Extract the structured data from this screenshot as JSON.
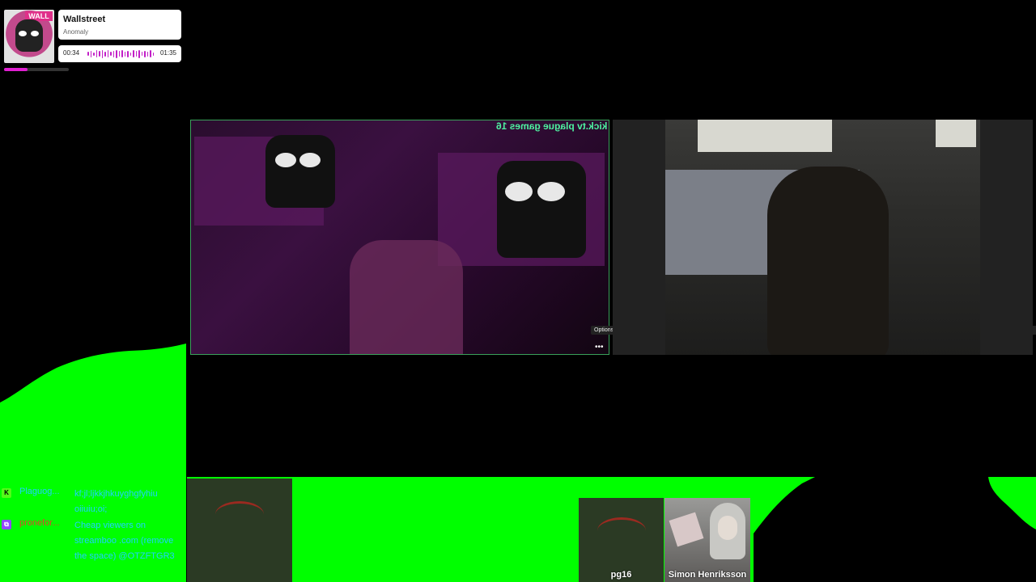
{
  "now_playing": {
    "album_art_text": "WALL",
    "title": "Wallstreet",
    "artist": "Anomaly",
    "elapsed": "00:34",
    "total": "01:35",
    "progress_fraction": 0.36,
    "accent_color": "#e11fd2"
  },
  "chat": {
    "messages": [
      {
        "platform": "kick",
        "platform_icon": "K",
        "username": "Plaguog...",
        "user_color": "#1fd0ff",
        "message": "kf;jl;ljkkjhkuyghgfyhiu oiiuiu;oi;"
      },
      {
        "platform": "twitch",
        "platform_icon": "⧉",
        "username": "pronefor...",
        "user_color": "#e0442c",
        "message": "Cheap viewers on streamboo .com (remove the space) @OTZFTGR3"
      }
    ]
  },
  "video_left": {
    "caption": "kick.tv plague games 16",
    "options_tooltip": "Options",
    "options_icon": "•••"
  },
  "tiles": [
    {
      "label": ""
    },
    {
      "label": "pg16"
    },
    {
      "label": "Simon Henriksson"
    }
  ],
  "colors": {
    "chroma_green": "#00ff00",
    "frame_green": "#3aa05a"
  }
}
